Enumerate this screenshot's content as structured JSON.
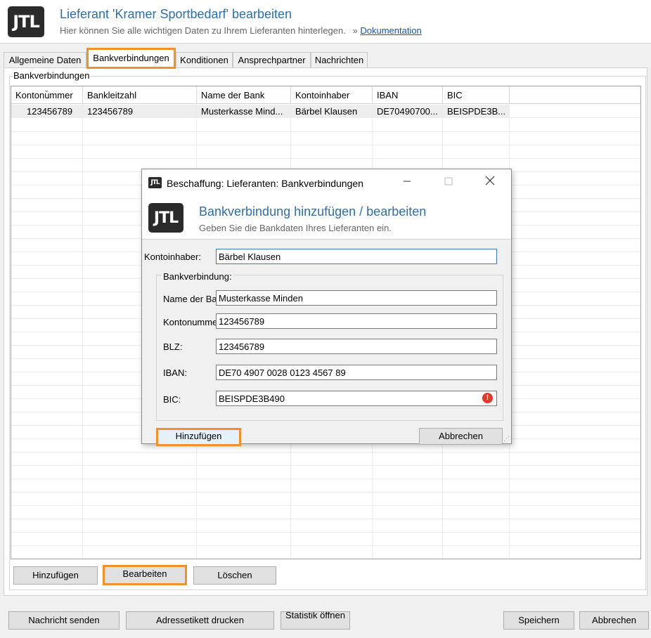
{
  "header": {
    "title": "Lieferant 'Kramer Sportbedarf' bearbeiten",
    "subtitle": "Hier können Sie alle wichtigen Daten zu Ihrem Lieferanten hinterlegen.",
    "doc_prefix": "»",
    "doc_link": "Dokumentation",
    "logo": "JTL"
  },
  "tabs": [
    {
      "label": "Allgemeine Daten"
    },
    {
      "label": "Bankverbindungen",
      "active": true
    },
    {
      "label": "Konditionen"
    },
    {
      "label": "Ansprechpartner"
    },
    {
      "label": "Nachrichten"
    }
  ],
  "group_label": "Bankverbindungen",
  "grid": {
    "columns": [
      "Kontonummer",
      "Bankleitzahl",
      "Name der Bank",
      "Kontoinhaber",
      "IBAN",
      "BIC"
    ],
    "rows": [
      [
        "123456789",
        "123456789",
        "Musterkasse Mind...",
        "Bärbel Klausen",
        "DE70490700...",
        "BEISPDE3B..."
      ]
    ]
  },
  "grid_buttons": {
    "add": "Hinzufügen",
    "edit": "Bearbeiten",
    "delete": "Löschen"
  },
  "footer_buttons": {
    "send_message": "Nachricht senden",
    "print_label": "Adressetikett drucken",
    "statistics": "Statistik öffnen",
    "save": "Speichern",
    "cancel": "Abbrechen"
  },
  "dialog": {
    "window_title": "Beschaffung: Lieferanten: Bankverbindungen",
    "logo": "JTL",
    "heading": "Bankverbindung hinzufügen / bearbeiten",
    "subheading": "Geben Sie die Bankdaten Ihres Lieferanten ein.",
    "account_holder_label": "Kontoinhaber:",
    "account_holder_value": "Bärbel Klausen",
    "bank_group_label": "Bankverbindung:",
    "bank_name_label": "Name der Bank:",
    "bank_name_value": "Musterkasse Minden",
    "account_number_label": "Kontonummer:",
    "account_number_value": "123456789",
    "blz_label": "BLZ:",
    "blz_value": "123456789",
    "iban_label": "IBAN:",
    "iban_value": "DE70 4907 0028 0123 4567 89",
    "bic_label": "BIC:",
    "bic_value": "BEISPDE3B490",
    "add_button": "Hinzufügen",
    "cancel_button": "Abbrechen",
    "warning_icon": "error-icon",
    "warning_color": "#e03a2a"
  },
  "colors": {
    "accent": "#2f6fa8",
    "highlight": "#f0912a",
    "link": "#1a56a8"
  }
}
